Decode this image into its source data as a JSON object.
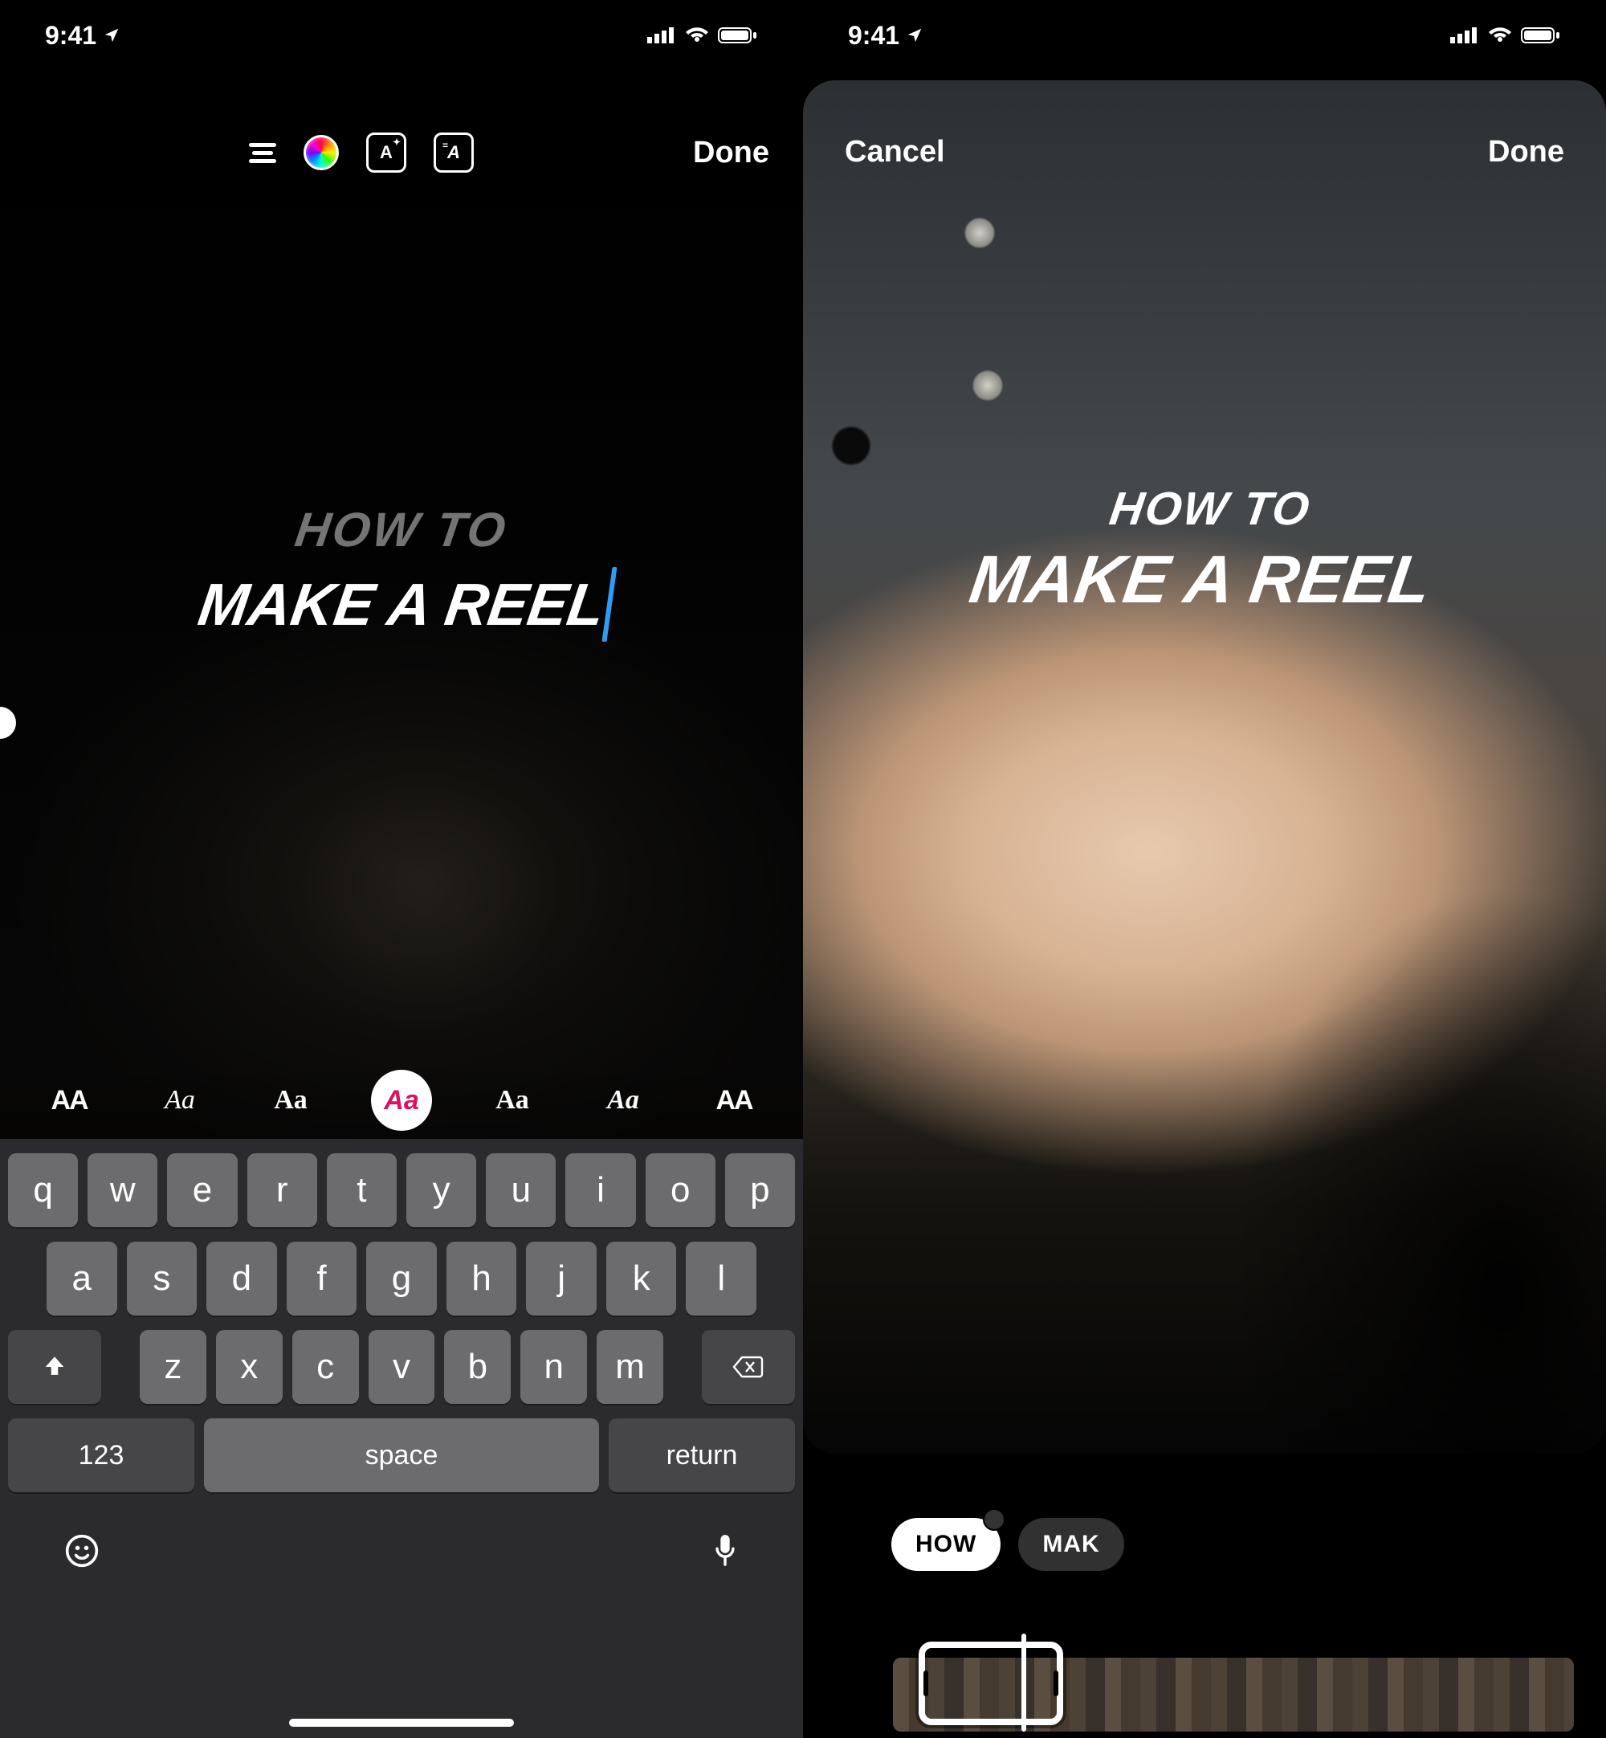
{
  "status": {
    "time": "9:41"
  },
  "left": {
    "toolbar": {
      "animation_btn": "A",
      "effects_btn": "A",
      "done": "Done"
    },
    "text": {
      "line1": "HOW TO",
      "line2": "MAKE A REEL"
    },
    "fonts": {
      "opts": [
        "AA",
        "Aa",
        "Aa",
        "Aa",
        "Aa",
        "Aa",
        "AA"
      ],
      "active_index": 3
    },
    "keyboard": {
      "row1": [
        "q",
        "w",
        "e",
        "r",
        "t",
        "y",
        "u",
        "i",
        "o",
        "p"
      ],
      "row2": [
        "a",
        "s",
        "d",
        "f",
        "g",
        "h",
        "j",
        "k",
        "l"
      ],
      "row3": [
        "z",
        "x",
        "c",
        "v",
        "b",
        "n",
        "m"
      ],
      "numbers": "123",
      "space": "space",
      "return": "return"
    }
  },
  "right": {
    "cancel": "Cancel",
    "done": "Done",
    "text": {
      "line1": "HOW TO",
      "line2": "MAKE A REEL"
    },
    "chips": {
      "a": "HOW",
      "b": "MAK"
    }
  }
}
